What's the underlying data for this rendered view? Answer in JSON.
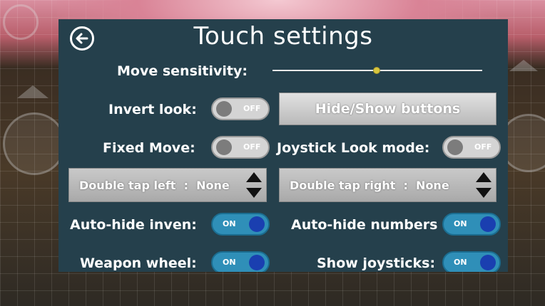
{
  "title": "Touch settings",
  "move_sensitivity": {
    "label": "Move sensitivity:",
    "value": 0.5
  },
  "invert_look": {
    "label": "Invert look:",
    "state": "OFF"
  },
  "hide_show_button": {
    "label": "Hide/Show buttons"
  },
  "fixed_move": {
    "label": "Fixed Move:",
    "state": "OFF"
  },
  "joystick_look_mode": {
    "label": "Joystick Look mode:",
    "state": "OFF"
  },
  "double_tap_left": {
    "label": "Double tap left",
    "separator": ":",
    "value": "None"
  },
  "double_tap_right": {
    "label": "Double tap right",
    "separator": ":",
    "value": "None"
  },
  "auto_hide_inven": {
    "label": "Auto-hide inven:",
    "state": "ON"
  },
  "auto_hide_numbers": {
    "label": "Auto-hide numbers",
    "state": "ON"
  },
  "weapon_wheel": {
    "label": "Weapon wheel:",
    "state": "ON"
  },
  "show_joysticks": {
    "label": "Show joysticks:",
    "state": "ON"
  },
  "colors": {
    "panel": "#25404c",
    "toggle_on": "#2f8fb8",
    "knob_on": "#1a3fb0",
    "slider_thumb": "#d8c63e"
  },
  "icons": {
    "back": "back-arrow-icon",
    "dropdown": "up-down-arrows-icon"
  }
}
